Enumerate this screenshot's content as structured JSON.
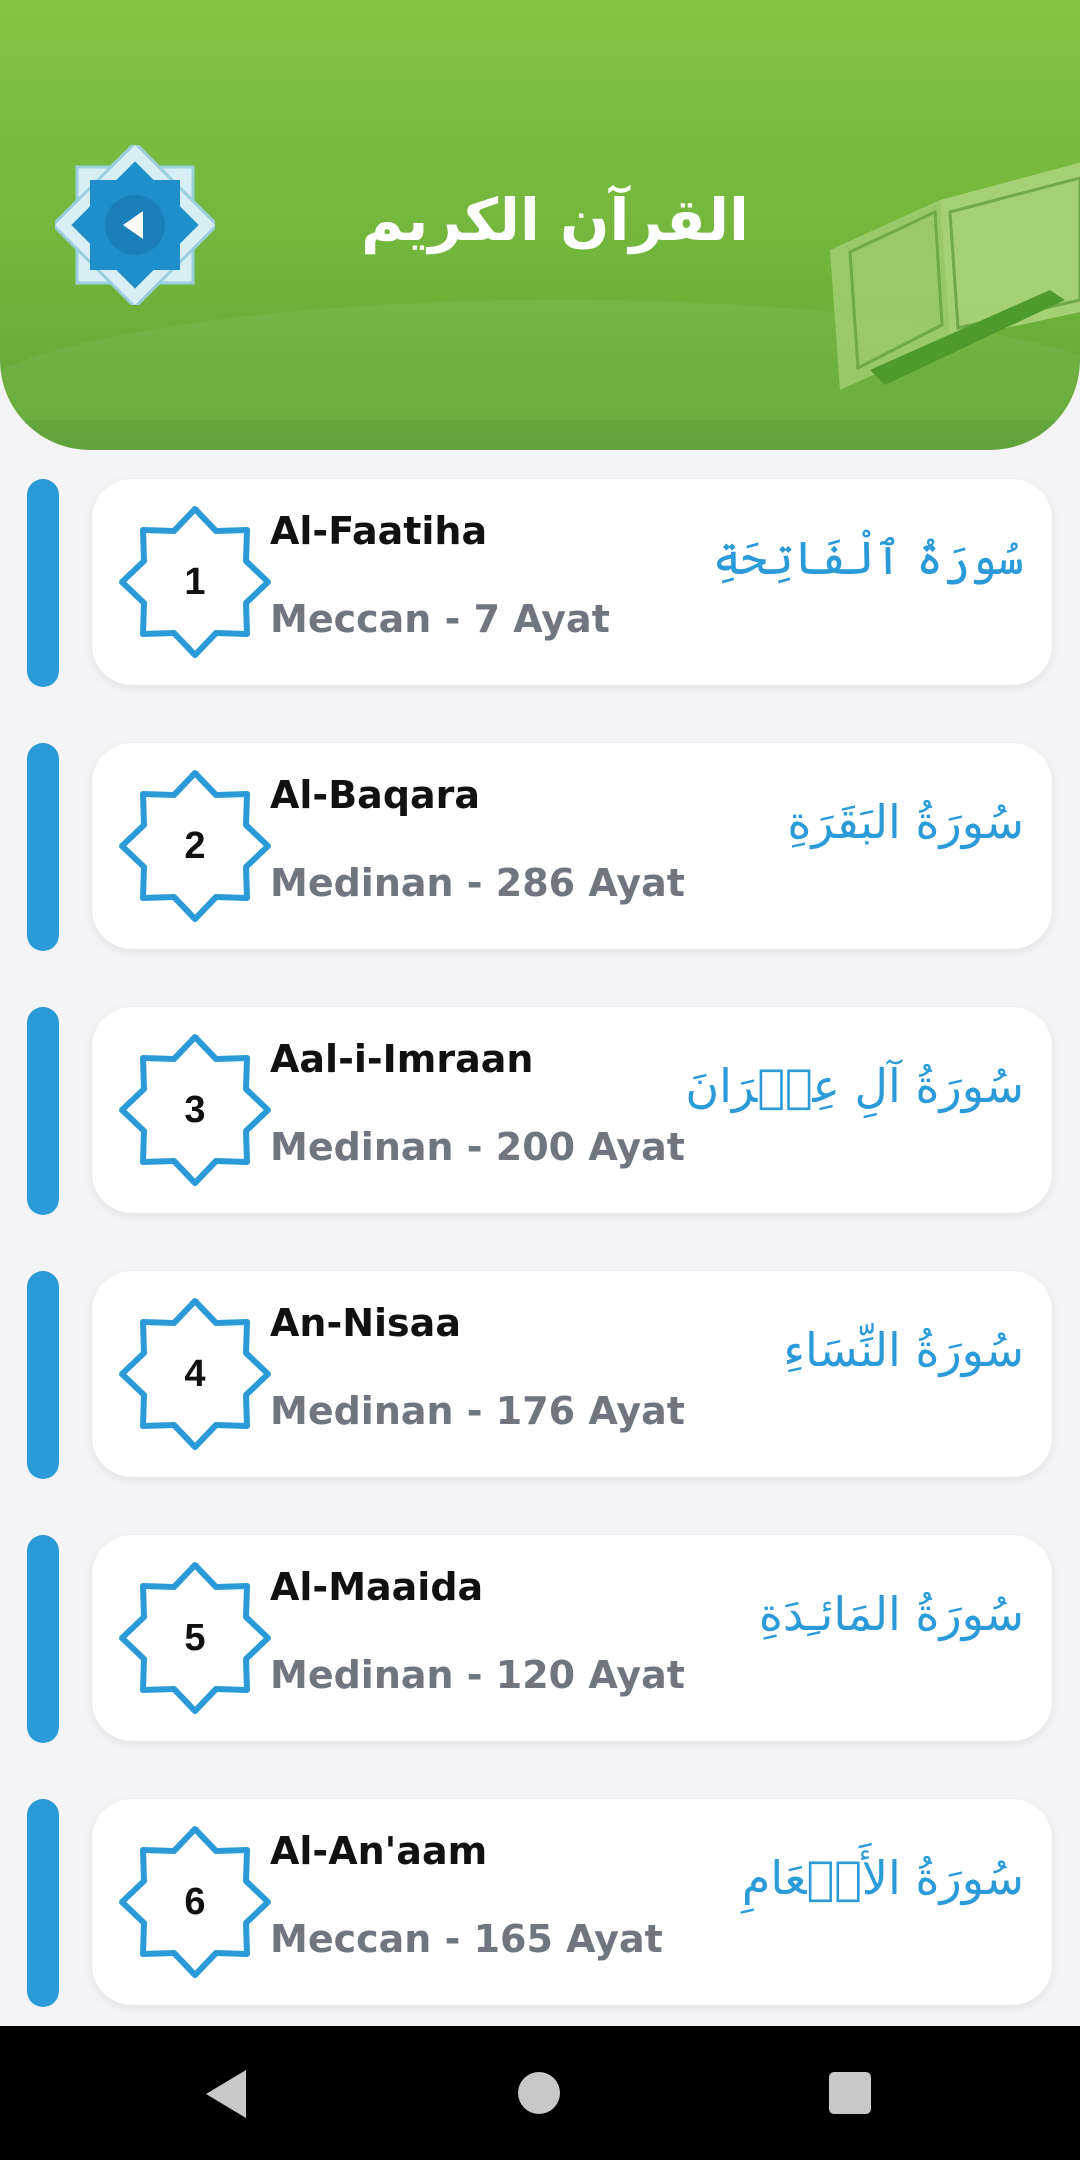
{
  "app": {
    "title": "القرآن الكريم"
  },
  "colors": {
    "header_green": "#78bb3e",
    "accent_blue": "#2a9bd8",
    "card_bg": "#ffffff",
    "page_bg": "#f4f4f7",
    "text_dark": "#111111",
    "text_muted": "#6f7680"
  },
  "icons": {
    "logo": "octagram-play-logo-icon",
    "decoration": "open-quran-book-icon",
    "badge": "octagram-star-icon",
    "nav_back": "back-triangle-icon",
    "nav_home": "home-circle-icon",
    "nav_recent": "recents-square-icon"
  },
  "surahs": [
    {
      "number": "1",
      "name": "Al-Faatiha",
      "meta": "Meccan - 7 Ayat",
      "arabic": "سُورَةُ ٱلْفَاتِحَةِ"
    },
    {
      "number": "2",
      "name": "Al-Baqara",
      "meta": "Medinan - 286 Ayat",
      "arabic": "سُورَةُ البَقَرَةِ"
    },
    {
      "number": "3",
      "name": "Aal-i-Imraan",
      "meta": "Medinan - 200 Ayat",
      "arabic": "سُورَةُ آلِ عِمۡرَانَ"
    },
    {
      "number": "4",
      "name": "An-Nisaa",
      "meta": "Medinan - 176 Ayat",
      "arabic": "سُورَةُ النِّسَاءِ"
    },
    {
      "number": "5",
      "name": "Al-Maaida",
      "meta": "Medinan - 120 Ayat",
      "arabic": "سُورَةُ المَائـِدَةِ"
    },
    {
      "number": "6",
      "name": "Al-An'aam",
      "meta": "Meccan - 165 Ayat",
      "arabic": "سُورَةُ الأَنۡعَامِ"
    }
  ]
}
